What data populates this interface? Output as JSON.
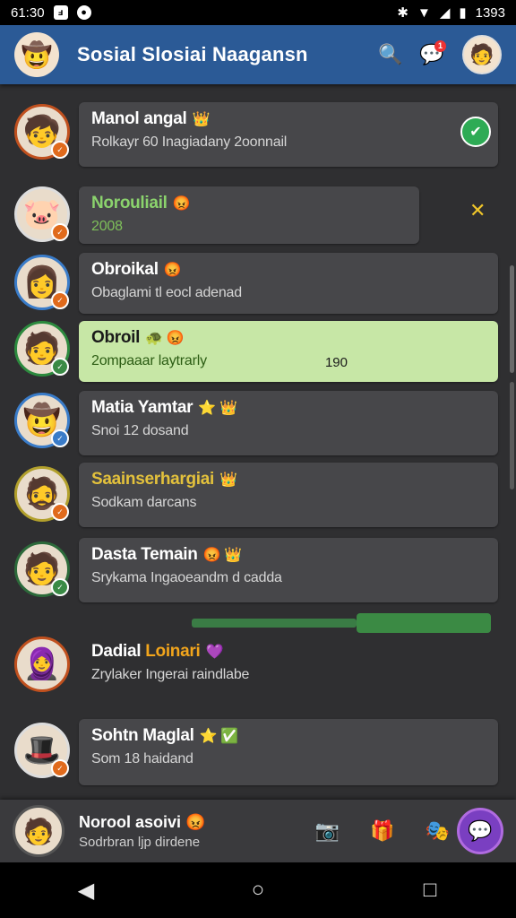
{
  "status_bar": {
    "time": "61:30",
    "right_text": "1393"
  },
  "app_bar": {
    "title": "Sosial Slosiai Naagansn",
    "notification_badge": "1"
  },
  "chats": [
    {
      "name": "Manol angal",
      "emoji": "👑",
      "preview": "Rolkayr 60 Inagiadany 2oonnail"
    },
    {
      "name": "Norouliail",
      "emoji": "😡",
      "preview": "2008"
    },
    {
      "name": "Obroikal",
      "emoji": "😡",
      "preview": "Obaglami tl eocl adenad"
    },
    {
      "name": "Obroil",
      "emoji": "🐢 😡",
      "preview": "2ompaaar laytrarly",
      "time": "190"
    },
    {
      "name": "Matia Yamtar",
      "emoji": "⭐ 👑",
      "preview": "Snoi 12 dosand"
    },
    {
      "name": "Saainserhargiai",
      "emoji": "👑",
      "preview": "Sodkam darcans"
    },
    {
      "name": "Dasta Temain",
      "emoji": "😡 👑",
      "preview": "Srykama Ingaoeandm d cadda"
    },
    {
      "name_part1": "Dadial",
      "name_part2": "Loinari",
      "emoji": "💜",
      "preview": "Zrylaker Ingerai raindlabe"
    },
    {
      "name": "Sohtn Maglal",
      "emoji": "⭐ ✅",
      "preview": "Som 18 haidand"
    }
  ],
  "composer": {
    "name": "Norool asoivi",
    "emoji": "😡",
    "sub": "Sodrbran ljp dirdene"
  }
}
